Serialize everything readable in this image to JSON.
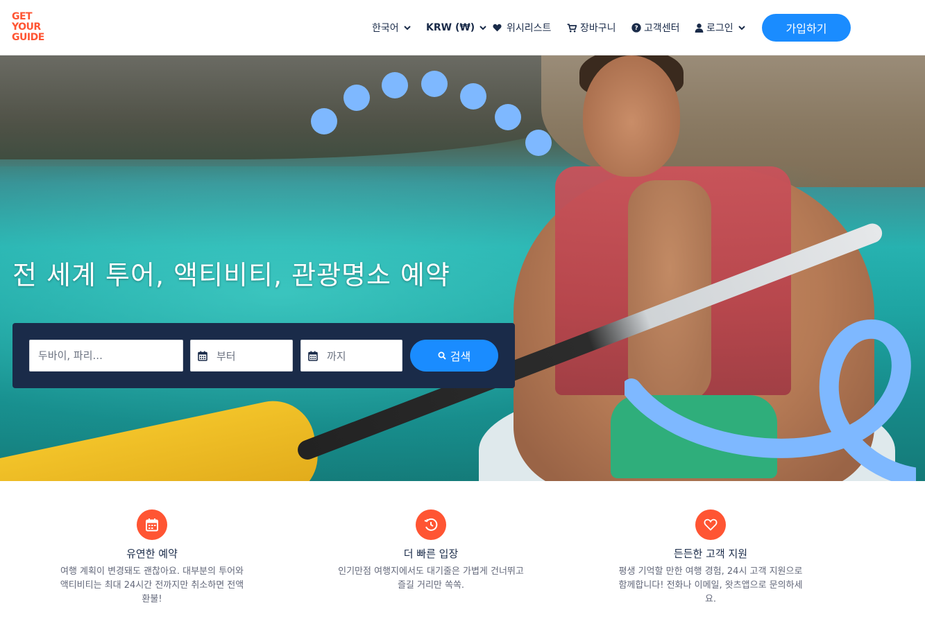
{
  "header": {
    "logo_lines": [
      "GET",
      "YOUR",
      "GUIDE"
    ],
    "language": "한국어",
    "currency": "KRW (₩)",
    "wishlist": "위시리스트",
    "cart": "장바구니",
    "help": "고객센터",
    "login": "로그인",
    "signup": "가입하기"
  },
  "hero": {
    "title": "전 세계 투어, 액티비티, 관광명소 예약",
    "search": {
      "destination_placeholder": "두바이, 파리...",
      "from_placeholder": "부터",
      "to_placeholder": "까지",
      "button": "검색"
    }
  },
  "features": [
    {
      "icon": "calendar-icon",
      "title": "유연한 예약",
      "desc": "여행 계획이 변경돼도 괜찮아요. 대부분의 투어와 액티비티는 최대 24시간 전까지만 취소하면 전액 환불!"
    },
    {
      "icon": "fast-clock-icon",
      "title": "더 빠른 입장",
      "desc": "인기만점 여행지에서도 대기줄은 가볍게 건너뛰고 즐길 거리만 쏙쏙."
    },
    {
      "icon": "heart-icon",
      "title": "든든한 고객 지원",
      "desc": "평생 기억할 만한 여행 경험, 24시 고객 지원으로 함께합니다! 전화나 이메일, 왓츠앱으로 문의하세요."
    }
  ],
  "colors": {
    "brand_orange": "#ff5533",
    "primary_blue": "#1a8cff",
    "navy": "#1a2b49",
    "accent_light_blue": "#7eb8ff"
  }
}
